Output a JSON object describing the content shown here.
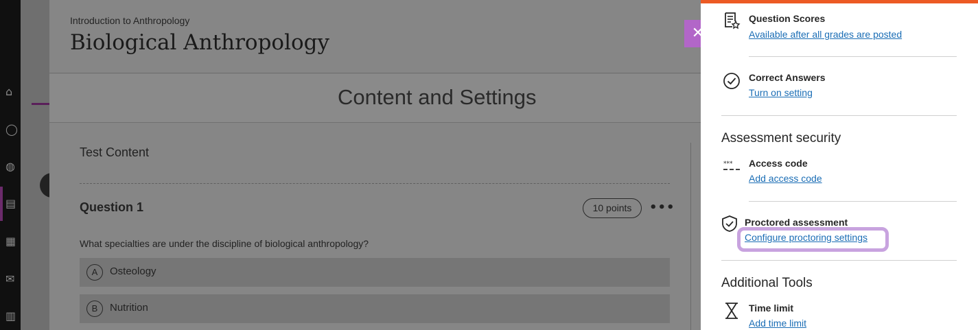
{
  "course": {
    "breadcrumb": "Introduction to Anthropology",
    "title": "Biological Anthropology"
  },
  "modal": {
    "heading": "Content and Settings",
    "test_content_label": "Test Content",
    "question": {
      "title": "Question 1",
      "points": "10 points",
      "more_label": "•••",
      "text": "What specialties are under the discipline of biological anthropology?",
      "answers": [
        {
          "letter": "A",
          "text": "Osteology"
        },
        {
          "letter": "B",
          "text": "Nutrition"
        }
      ]
    }
  },
  "close_button": {
    "label": "✕"
  },
  "panel": {
    "accent_color": "#ec5a24",
    "question_scores": {
      "title": "Question Scores",
      "link": "Available after all grades are posted",
      "icon": "certificate-icon"
    },
    "correct_answers": {
      "title": "Correct Answers",
      "link": "Turn on setting",
      "icon": "check-circle-icon"
    },
    "security_heading": "Assessment security",
    "access_code": {
      "title": "Access code",
      "link": "Add access code",
      "icon": "password-dots-icon"
    },
    "proctored": {
      "title": "Proctored assessment",
      "link": "Configure proctoring settings",
      "icon": "shield-icon"
    },
    "tools_heading": "Additional Tools",
    "time_limit": {
      "title": "Time limit",
      "link": "Add time limit",
      "icon": "hourglass-icon"
    }
  }
}
